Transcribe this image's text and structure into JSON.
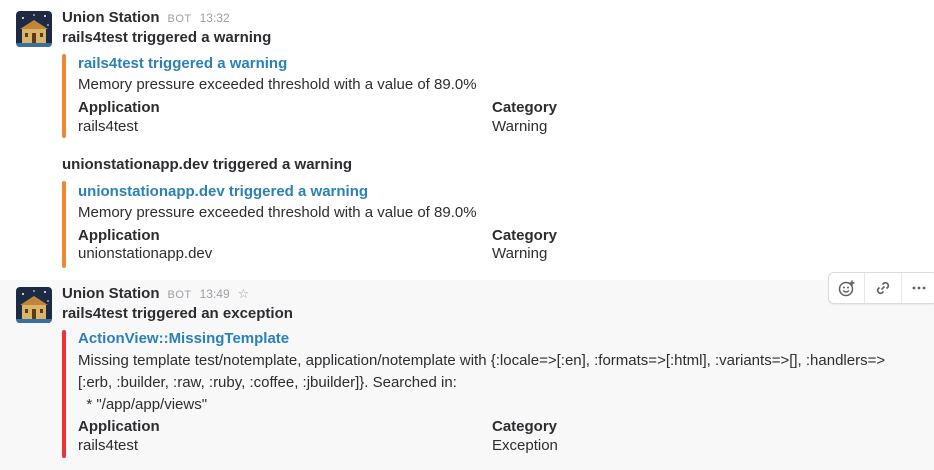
{
  "messages": [
    {
      "sender": "Union Station",
      "bot_badge": "BOT",
      "time": "13:32",
      "summary": "rails4test triggered a warning",
      "attachments": [
        {
          "title": "rails4test triggered a warning",
          "text": "Memory pressure exceeded threshold with a value of 89.0%",
          "color": "#f0882e",
          "fields": [
            {
              "title": "Application",
              "value": "rails4test"
            },
            {
              "title": "Category",
              "value": "Warning"
            }
          ]
        }
      ]
    },
    {
      "summary": "unionstationapp.dev triggered a warning",
      "attachments": [
        {
          "title": "unionstationapp.dev triggered a warning",
          "text": "Memory pressure exceeded threshold with a value of 89.0%",
          "color": "#f0882e",
          "fields": [
            {
              "title": "Application",
              "value": "unionstationapp.dev"
            },
            {
              "title": "Category",
              "value": "Warning"
            }
          ]
        }
      ]
    },
    {
      "sender": "Union Station",
      "bot_badge": "BOT",
      "time": "13:49",
      "star_icon": "star-outline-icon",
      "summary": "rails4test triggered an exception",
      "attachments": [
        {
          "title": "ActionView::MissingTemplate",
          "text_lines": [
            "Missing template test/notemplate, application/notemplate with {:locale=>[:en], :formats=>[:html], :variants=>[], :handlers=>",
            "[:erb, :builder, :raw, :ruby, :coffee, :jbuilder]}. Searched in:",
            "  * \"/app/app/views\""
          ],
          "color": "#e8333a",
          "fields": [
            {
              "title": "Application",
              "value": "rails4test"
            },
            {
              "title": "Category",
              "value": "Exception"
            }
          ]
        }
      ]
    }
  ],
  "hover_toolbar": {
    "buttons": [
      "add-reaction-icon",
      "link-icon",
      "more-actions-icon"
    ]
  }
}
